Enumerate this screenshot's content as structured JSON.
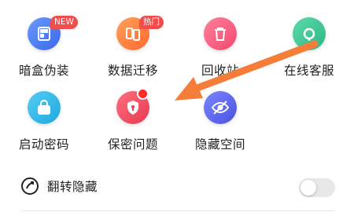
{
  "grid": {
    "items": [
      {
        "label": "暗盒伪装",
        "icon": "disguise-icon",
        "color": "#4a7cf6",
        "badge": "NEW"
      },
      {
        "label": "数据迁移",
        "icon": "data-transfer-icon",
        "color": "#ff7a3c",
        "badge": "热门"
      },
      {
        "label": "回收站",
        "icon": "trash-icon",
        "color": "#f2567a",
        "badge": ""
      },
      {
        "label": "在线客服",
        "icon": "headset-icon",
        "color": "#39c391",
        "badge": ""
      },
      {
        "label": "启动密码",
        "icon": "lock-icon",
        "color": "#2bb6e6",
        "badge": ""
      },
      {
        "label": "保密问题",
        "icon": "shield-icon",
        "color": "#f0485e",
        "badge": ""
      },
      {
        "label": "隐藏空间",
        "icon": "eye-off-icon",
        "color": "#5a63e8",
        "badge": ""
      }
    ]
  },
  "flip_hide": {
    "label": "翻转隐藏",
    "icon": "flip-icon",
    "enabled": false
  },
  "overlay": {
    "arrow_color": "#f47d3a"
  }
}
